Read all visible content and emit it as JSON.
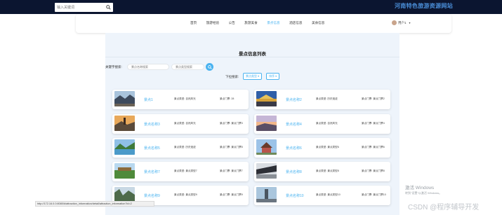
{
  "header": {
    "search_placeholder": "输入关键词",
    "site_title": "河南特色旅游资源网站"
  },
  "nav": {
    "items": [
      {
        "label": "首页",
        "active": false
      },
      {
        "label": "旅游经验",
        "active": false
      },
      {
        "label": "公告",
        "active": false
      },
      {
        "label": "旅游美食",
        "active": false
      },
      {
        "label": "景点信息",
        "active": true
      },
      {
        "label": "酒店信息",
        "active": false
      },
      {
        "label": "美食信息",
        "active": false
      }
    ],
    "user_name": "用户1"
  },
  "page": {
    "heading": "景点信息列表",
    "keyword_label": "关键字搜索:",
    "name_placeholder": "景点名称搜索",
    "type_placeholder": "景点类型搜索",
    "filter_label": "下拉搜索:",
    "type_dropdown": "景点类型",
    "sort_dropdown": "排序"
  },
  "cards": [
    {
      "name": "景点1",
      "type": "景点类型: 自然风光",
      "ticket": "景点门票: 28",
      "thumb": "mountain"
    },
    {
      "name": "景点名称2",
      "type": "景点类型: 历史遗迹",
      "ticket": "景点门票: 景点门票2",
      "thumb": "palace"
    },
    {
      "name": "景点名称3",
      "type": "景点类型: 自然风光",
      "ticket": "景点门票: 景点门票3",
      "thumb": "pagoda"
    },
    {
      "name": "景点名称4",
      "type": "景点类型: 自然风光",
      "ticket": "景点门票: 景点门票4",
      "thumb": "sunset"
    },
    {
      "name": "景点名称5",
      "type": "景点类型: 历史遗迹",
      "ticket": "景点门票: 景点门票5",
      "thumb": "lake"
    },
    {
      "name": "景点名称6",
      "type": "景点类型: 景点类型6",
      "ticket": "景点门票: 景点门票6",
      "thumb": "temple"
    },
    {
      "name": "景点名称7",
      "type": "景点类型: 景点类型7",
      "ticket": "景点门票: 景点门票7",
      "thumb": "garden"
    },
    {
      "name": "景点名称8",
      "type": "景点类型: 景点类型8",
      "ticket": "景点门票: 景点门票8",
      "thumb": "eaves"
    },
    {
      "name": "景点名称9",
      "type": "景点类型: 景点类型9",
      "ticket": "景点门票: 景点门票9",
      "thumb": "cliff"
    },
    {
      "name": "景点名称10",
      "type": "景点类型: 景点类型10",
      "ticket": "景点门票: 景点门票10",
      "thumb": "statue"
    }
  ],
  "status_url": "http://172.16.0.0:8080/#/attraction_information/detail/attraction_information?id=2",
  "windows_watermark": {
    "title": "激活 Windows",
    "subtitle": "转到\"设置\"以激活 Windows。"
  },
  "csdn_watermark": "CSDN @程序辅导开发",
  "colors": {
    "accent": "#4ab3f0",
    "topbar": "#0b1530",
    "content_bg": "#eef4fb"
  }
}
